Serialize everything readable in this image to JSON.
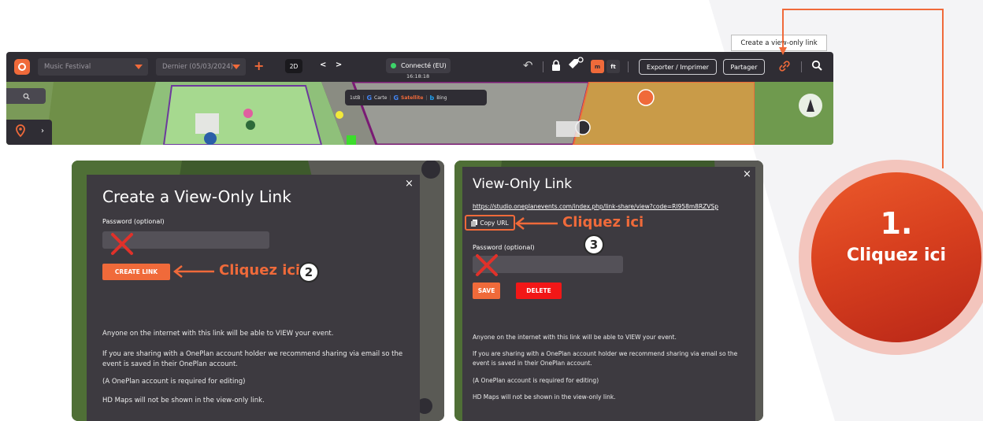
{
  "toolbar": {
    "project": "Music Festival",
    "version": "Dernier (05/03/2024)",
    "add_label": "+",
    "mode_2d": "2D",
    "nav_arrows": "< >",
    "connection_status": "Connecté (EU)",
    "clock": "16:18:18",
    "unit_m": "m",
    "unit_ft": "ft",
    "export_label": "Exporter / Imprimer",
    "share_label": "Partager",
    "tooltip": "Create a view-only link"
  },
  "map": {
    "basemaps": [
      "1stB",
      "Carte",
      "Satellite",
      "Bing"
    ],
    "active_basemap": "Satellite"
  },
  "create_dialog": {
    "title": "Create a View-Only Link",
    "password_label": "Password (optional)",
    "create_button": "CREATE LINK",
    "info": [
      "Anyone on the internet with this link will be able to VIEW your event.",
      "If you are sharing with a OnePlan account holder we recommend sharing via email so the event is saved in their OnePlan account.",
      "(A OnePlan account is required for editing)",
      "HD Maps will not be shown in the view-only link."
    ]
  },
  "view_dialog": {
    "title": "View-Only Link",
    "url": "https://studio.oneplanevents.com/index.php/link-share/view?code=RI958m8RZVSp",
    "copy_button": "Copy URL",
    "password_label": "Password (optional)",
    "save_button": "SAVE",
    "delete_button": "DELETE",
    "info": [
      "Anyone on the internet with this link will be able to VIEW your event.",
      "If you are sharing with a OnePlan account holder we recommend sharing via email so the event is saved in their OnePlan account.",
      "(A OnePlan account is required for editing)",
      "HD Maps will not be shown in the view-only link."
    ]
  },
  "annotations": {
    "click_here": "Cliquez ici",
    "step2": "2",
    "step3": "3",
    "step1_num": "1.",
    "step1_text": "Cliquez ici"
  },
  "colors": {
    "accent": "#f06a3a",
    "danger": "#f21717",
    "dialog_bg": "#3d3a40",
    "toolbar_bg": "#2f2d34"
  }
}
